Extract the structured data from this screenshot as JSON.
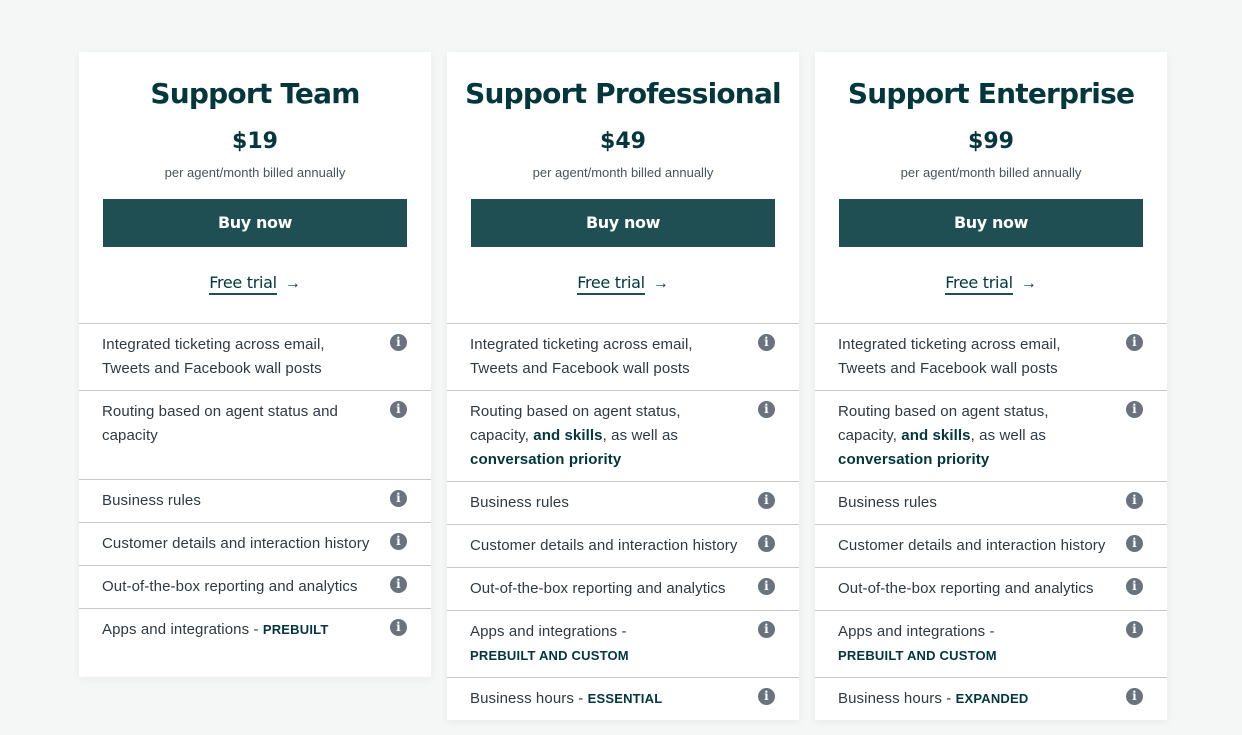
{
  "plans": [
    {
      "title": "Support Team",
      "price": "$19",
      "billing": "per agent/month billed annually",
      "buy_label": "Buy now",
      "trial_label": "Free trial",
      "features": [
        {
          "text": "Integrated ticketing across email, Tweets and Facebook wall posts"
        },
        {
          "text": "Routing based on agent status and capacity"
        },
        {
          "text": "Business rules"
        },
        {
          "text": "Customer details and interaction history"
        },
        {
          "text": "Out-of-the-box reporting and analytics"
        },
        {
          "text": "Apps and integrations - ",
          "highlight": "PREBUILT"
        }
      ]
    },
    {
      "title": "Support Professional",
      "price": "$49",
      "billing": "per agent/month billed annually",
      "buy_label": "Buy now",
      "trial_label": "Free trial",
      "features": [
        {
          "text": "Integrated ticketing across email, Tweets and Facebook wall posts"
        },
        {
          "text": "Routing based on agent status, capacity, ",
          "bold1": "and skills",
          "text2": ", as well as ",
          "bold2": "conversation priority"
        },
        {
          "text": "Business rules"
        },
        {
          "text": "Customer details and interaction history"
        },
        {
          "text": "Out-of-the-box reporting and analytics"
        },
        {
          "text": "Apps and integrations - ",
          "highlight": "PREBUILT AND CUSTOM"
        },
        {
          "text": "Business hours - ",
          "highlight": "ESSENTIAL"
        }
      ]
    },
    {
      "title": "Support Enterprise",
      "price": "$99",
      "billing": "per agent/month billed annually",
      "buy_label": "Buy now",
      "trial_label": "Free trial",
      "features": [
        {
          "text": "Integrated ticketing across email, Tweets and Facebook wall posts"
        },
        {
          "text": "Routing based on agent status, capacity, ",
          "bold1": "and skills",
          "text2": ", as well as ",
          "bold2": "conversation priority"
        },
        {
          "text": "Business rules"
        },
        {
          "text": "Customer details and interaction history"
        },
        {
          "text": "Out-of-the-box reporting and analytics"
        },
        {
          "text": "Apps and integrations - ",
          "highlight": "PREBUILT AND CUSTOM"
        },
        {
          "text": "Business hours - ",
          "highlight": "EXPANDED"
        }
      ]
    }
  ],
  "icons": {
    "info": "info-icon",
    "arrow": "arrow-right-icon"
  },
  "colors": {
    "brand": "#03363d",
    "button": "#1f4f53",
    "background": "#f5f7f7"
  }
}
